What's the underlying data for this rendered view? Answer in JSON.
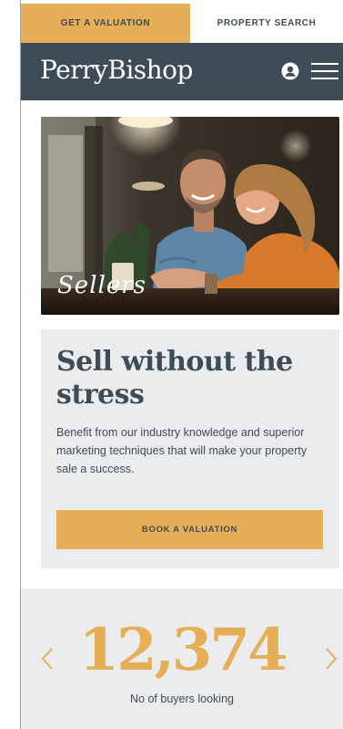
{
  "topbar": {
    "valuation_tab": "GET A VALUATION",
    "search_tab": "PROPERTY SEARCH"
  },
  "header": {
    "logo": "PerryBishop",
    "icons": [
      "user-icon",
      "hamburger-menu-icon"
    ]
  },
  "hero": {
    "caption": "Sellers"
  },
  "card": {
    "title": "Sell without the stress",
    "text": "Benefit from our industry knowledge and superior marketing techniques that will make your property sale a success.",
    "button": "BOOK A VALUATION"
  },
  "stats": {
    "value": "12,374",
    "label": "No of buyers looking",
    "prev_icon": "chevron-left-icon",
    "next_icon": "chevron-right-icon"
  },
  "colors": {
    "accent": "#e5ae57",
    "header": "#3d4c57",
    "panel": "#ebeced"
  }
}
